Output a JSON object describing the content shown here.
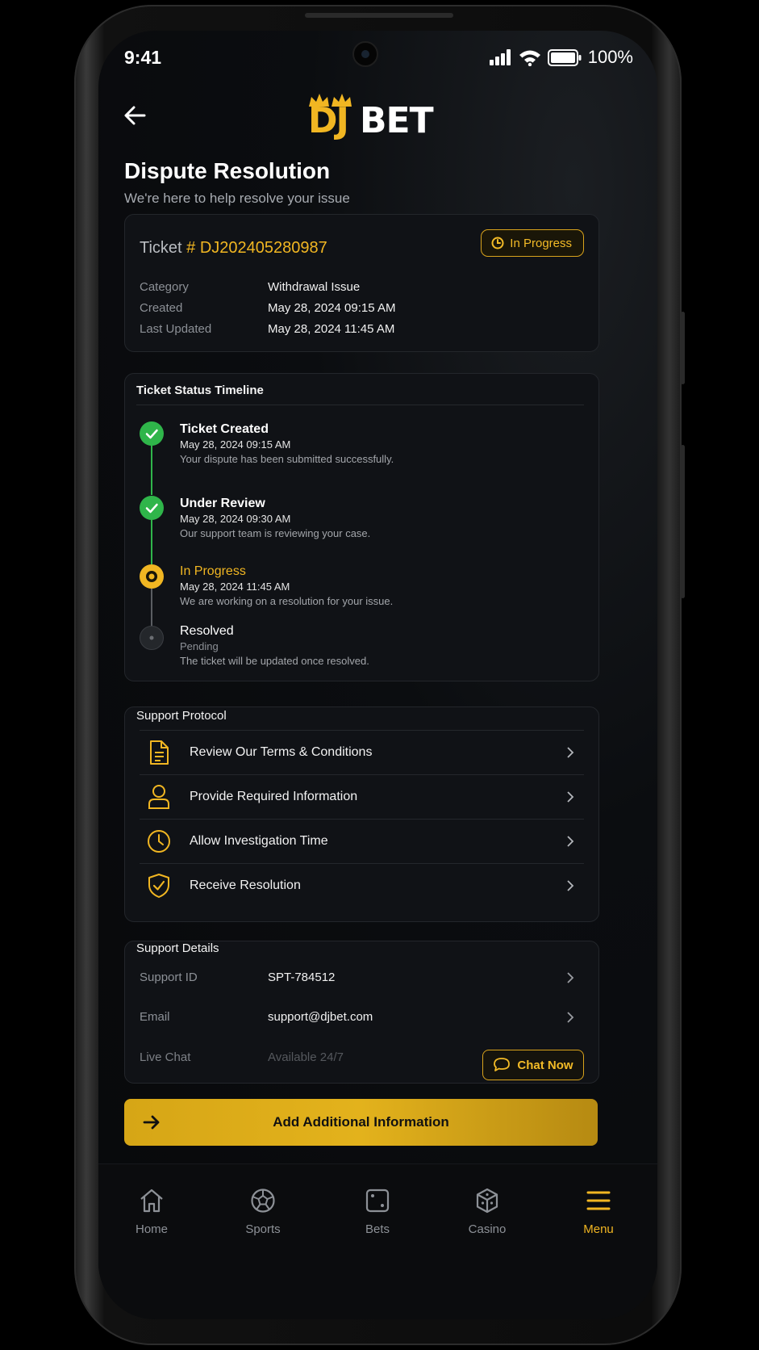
{
  "status_bar": {
    "time": "9:41",
    "battery": "100%"
  },
  "header": {
    "logo_dj": "DJ",
    "logo_bet": "BET"
  },
  "page": {
    "title": "Dispute Resolution",
    "subtitle": "We're here to help resolve your issue"
  },
  "ticket": {
    "label": "Ticket",
    "hash": "#",
    "id": "DJ202405280987",
    "status_badge": "In Progress",
    "rows": [
      {
        "key": "Category",
        "value": "Withdrawal Issue"
      },
      {
        "key": "Created",
        "value": "May 28, 2024 09:15 AM"
      },
      {
        "key": "Last Updated",
        "value": "May 28, 2024 11:45 AM"
      }
    ]
  },
  "timeline": {
    "title": "Ticket Status Timeline",
    "steps": [
      {
        "title": "Ticket Created",
        "date": "May 28, 2024 09:15 AM",
        "desc": "Your dispute has been submitted successfully.",
        "state": "done"
      },
      {
        "title": "Under Review",
        "date": "May 28, 2024 09:30 AM",
        "desc": "Our support team is reviewing your case.",
        "state": "done"
      },
      {
        "title": "In Progress",
        "date": "May 28, 2024 11:45 AM",
        "desc": "We are working on a resolution for your issue.",
        "state": "current"
      },
      {
        "title": "Resolved",
        "date": "Pending",
        "desc": "The ticket will be updated once resolved.",
        "state": "pending"
      }
    ]
  },
  "protocol": {
    "title": "Support Protocol",
    "items": [
      {
        "label": "Review Our Terms & Conditions",
        "icon": "document-icon"
      },
      {
        "label": "Provide Required Information",
        "icon": "user-icon"
      },
      {
        "label": "Allow Investigation Time",
        "icon": "clock-icon"
      },
      {
        "label": "Receive Resolution",
        "icon": "shield-icon"
      }
    ]
  },
  "support": {
    "title": "Support Details",
    "support_id_label": "Support ID",
    "support_id": "SPT-784512",
    "email_label": "Email",
    "email": "support@djbet.com",
    "live_chat_label": "Live Chat",
    "live_chat_value": "Available 24/7",
    "chat_button": "Chat Now"
  },
  "cta": {
    "label": "Add Additional Information"
  },
  "nav": {
    "items": [
      {
        "label": "Home",
        "icon": "home-icon"
      },
      {
        "label": "Sports",
        "icon": "ball-icon"
      },
      {
        "label": "Bets",
        "icon": "dice-icon"
      },
      {
        "label": "Casino",
        "icon": "cube-icon"
      },
      {
        "label": "Menu",
        "icon": "menu-icon"
      }
    ],
    "active": "Menu"
  },
  "colors": {
    "accent": "#f1b622",
    "success": "#2fb54a",
    "card": "#101216",
    "background": "#08090b"
  }
}
